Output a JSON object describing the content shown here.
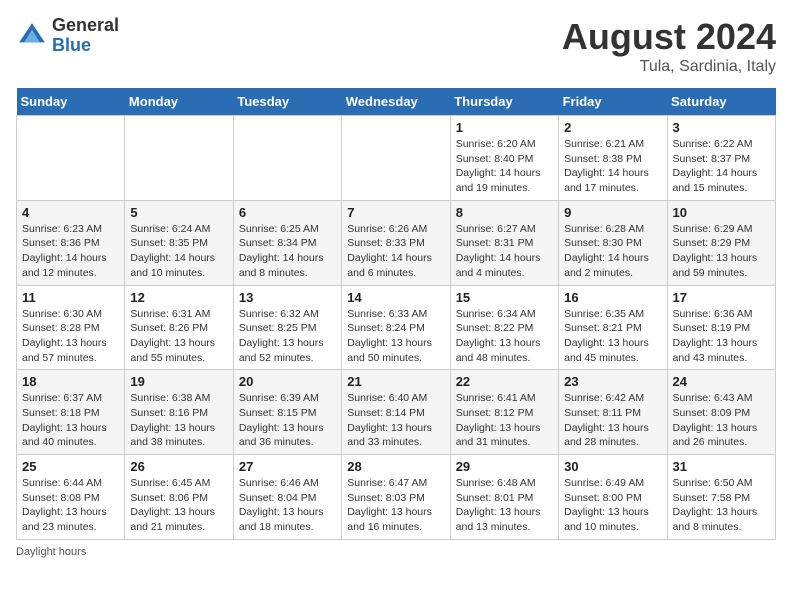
{
  "logo": {
    "general": "General",
    "blue": "Blue"
  },
  "title": "August 2024",
  "location": "Tula, Sardinia, Italy",
  "days_of_week": [
    "Sunday",
    "Monday",
    "Tuesday",
    "Wednesday",
    "Thursday",
    "Friday",
    "Saturday"
  ],
  "weeks": [
    [
      {
        "day": "",
        "info": ""
      },
      {
        "day": "",
        "info": ""
      },
      {
        "day": "",
        "info": ""
      },
      {
        "day": "",
        "info": ""
      },
      {
        "day": "1",
        "info": "Sunrise: 6:20 AM\nSunset: 8:40 PM\nDaylight: 14 hours and 19 minutes."
      },
      {
        "day": "2",
        "info": "Sunrise: 6:21 AM\nSunset: 8:38 PM\nDaylight: 14 hours and 17 minutes."
      },
      {
        "day": "3",
        "info": "Sunrise: 6:22 AM\nSunset: 8:37 PM\nDaylight: 14 hours and 15 minutes."
      }
    ],
    [
      {
        "day": "4",
        "info": "Sunrise: 6:23 AM\nSunset: 8:36 PM\nDaylight: 14 hours and 12 minutes."
      },
      {
        "day": "5",
        "info": "Sunrise: 6:24 AM\nSunset: 8:35 PM\nDaylight: 14 hours and 10 minutes."
      },
      {
        "day": "6",
        "info": "Sunrise: 6:25 AM\nSunset: 8:34 PM\nDaylight: 14 hours and 8 minutes."
      },
      {
        "day": "7",
        "info": "Sunrise: 6:26 AM\nSunset: 8:33 PM\nDaylight: 14 hours and 6 minutes."
      },
      {
        "day": "8",
        "info": "Sunrise: 6:27 AM\nSunset: 8:31 PM\nDaylight: 14 hours and 4 minutes."
      },
      {
        "day": "9",
        "info": "Sunrise: 6:28 AM\nSunset: 8:30 PM\nDaylight: 14 hours and 2 minutes."
      },
      {
        "day": "10",
        "info": "Sunrise: 6:29 AM\nSunset: 8:29 PM\nDaylight: 13 hours and 59 minutes."
      }
    ],
    [
      {
        "day": "11",
        "info": "Sunrise: 6:30 AM\nSunset: 8:28 PM\nDaylight: 13 hours and 57 minutes."
      },
      {
        "day": "12",
        "info": "Sunrise: 6:31 AM\nSunset: 8:26 PM\nDaylight: 13 hours and 55 minutes."
      },
      {
        "day": "13",
        "info": "Sunrise: 6:32 AM\nSunset: 8:25 PM\nDaylight: 13 hours and 52 minutes."
      },
      {
        "day": "14",
        "info": "Sunrise: 6:33 AM\nSunset: 8:24 PM\nDaylight: 13 hours and 50 minutes."
      },
      {
        "day": "15",
        "info": "Sunrise: 6:34 AM\nSunset: 8:22 PM\nDaylight: 13 hours and 48 minutes."
      },
      {
        "day": "16",
        "info": "Sunrise: 6:35 AM\nSunset: 8:21 PM\nDaylight: 13 hours and 45 minutes."
      },
      {
        "day": "17",
        "info": "Sunrise: 6:36 AM\nSunset: 8:19 PM\nDaylight: 13 hours and 43 minutes."
      }
    ],
    [
      {
        "day": "18",
        "info": "Sunrise: 6:37 AM\nSunset: 8:18 PM\nDaylight: 13 hours and 40 minutes."
      },
      {
        "day": "19",
        "info": "Sunrise: 6:38 AM\nSunset: 8:16 PM\nDaylight: 13 hours and 38 minutes."
      },
      {
        "day": "20",
        "info": "Sunrise: 6:39 AM\nSunset: 8:15 PM\nDaylight: 13 hours and 36 minutes."
      },
      {
        "day": "21",
        "info": "Sunrise: 6:40 AM\nSunset: 8:14 PM\nDaylight: 13 hours and 33 minutes."
      },
      {
        "day": "22",
        "info": "Sunrise: 6:41 AM\nSunset: 8:12 PM\nDaylight: 13 hours and 31 minutes."
      },
      {
        "day": "23",
        "info": "Sunrise: 6:42 AM\nSunset: 8:11 PM\nDaylight: 13 hours and 28 minutes."
      },
      {
        "day": "24",
        "info": "Sunrise: 6:43 AM\nSunset: 8:09 PM\nDaylight: 13 hours and 26 minutes."
      }
    ],
    [
      {
        "day": "25",
        "info": "Sunrise: 6:44 AM\nSunset: 8:08 PM\nDaylight: 13 hours and 23 minutes."
      },
      {
        "day": "26",
        "info": "Sunrise: 6:45 AM\nSunset: 8:06 PM\nDaylight: 13 hours and 21 minutes."
      },
      {
        "day": "27",
        "info": "Sunrise: 6:46 AM\nSunset: 8:04 PM\nDaylight: 13 hours and 18 minutes."
      },
      {
        "day": "28",
        "info": "Sunrise: 6:47 AM\nSunset: 8:03 PM\nDaylight: 13 hours and 16 minutes."
      },
      {
        "day": "29",
        "info": "Sunrise: 6:48 AM\nSunset: 8:01 PM\nDaylight: 13 hours and 13 minutes."
      },
      {
        "day": "30",
        "info": "Sunrise: 6:49 AM\nSunset: 8:00 PM\nDaylight: 13 hours and 10 minutes."
      },
      {
        "day": "31",
        "info": "Sunrise: 6:50 AM\nSunset: 7:58 PM\nDaylight: 13 hours and 8 minutes."
      }
    ]
  ],
  "footer": "Daylight hours"
}
